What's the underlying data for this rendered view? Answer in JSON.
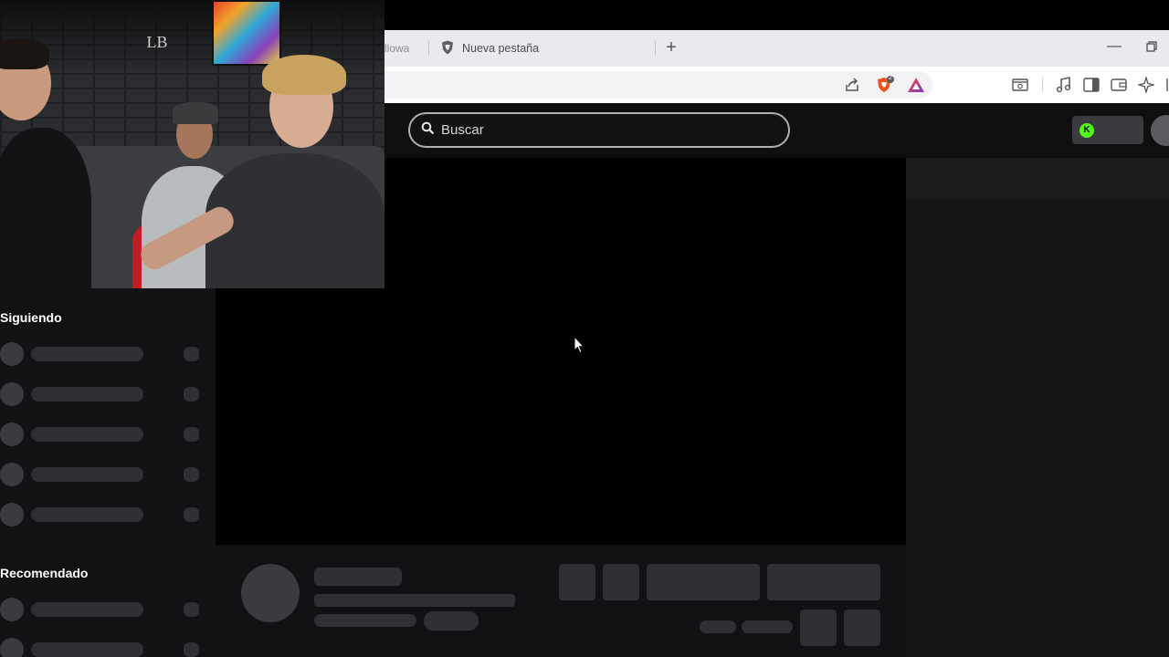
{
  "browser": {
    "previous_tab_fragment": "llowa",
    "active_tab": {
      "title": "Nueva pestaña",
      "icon": "brave-shield-icon"
    },
    "new_tab_symbol": "+",
    "minimize_symbol": "—",
    "brave_rewards_count": "2",
    "toolbar_icons": [
      "share-icon",
      "brave-shield-icon",
      "brave-rewards-icon",
      "tab-search-icon",
      "media-icon",
      "sidebar-icon",
      "wallet-icon",
      "leo-ai-icon"
    ]
  },
  "header": {
    "search_placeholder": "Buscar",
    "kick_badge": "K"
  },
  "webcam": {
    "logo_text": "LB"
  },
  "sidebar": {
    "following_title": "Siguiendo",
    "recommended_title": "Recomendado"
  },
  "colors": {
    "page_bg": "#000000",
    "panel_bg": "#121214",
    "skeleton": "#2f3034",
    "accent_green": "#53fc18"
  }
}
